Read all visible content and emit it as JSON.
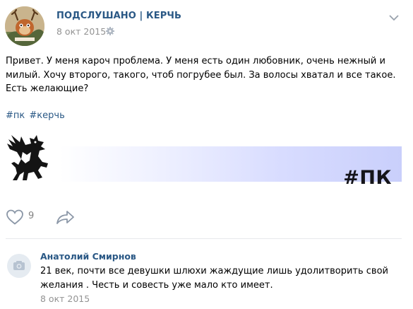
{
  "post": {
    "group_name": "ПОДСЛУШАНО | КЕРЧЬ",
    "date": "8 окт 2015",
    "text_lines": [
      "Привет. У меня кароч проблема. У меня есть один любовник, очень нежный и",
      "милый. Хочу второго, такого, чтоб погрубее был. За волосы хватал и все такое.",
      "Есть желающие?"
    ],
    "hashtags": [
      "#пк",
      "#керчь"
    ],
    "banner_label": "#ПК",
    "likes_count": "9"
  },
  "icons": {
    "settings": "gear-icon",
    "menu": "chevron-down-icon",
    "like": "heart-icon",
    "share": "share-arrow-icon",
    "comment_avatar": "camera-icon"
  },
  "comment": {
    "author": "Анатолий Смирнов",
    "text_lines": [
      "21 век, почти все девушки шлюхи жаждущие лишь удолитворить свой",
      "желания . Честь и совесть уже мало кто имеет."
    ],
    "date": "8 окт 2015"
  },
  "colors": {
    "link": "#2a5885",
    "muted": "#939393",
    "banner_accent": "#c9cffb"
  }
}
